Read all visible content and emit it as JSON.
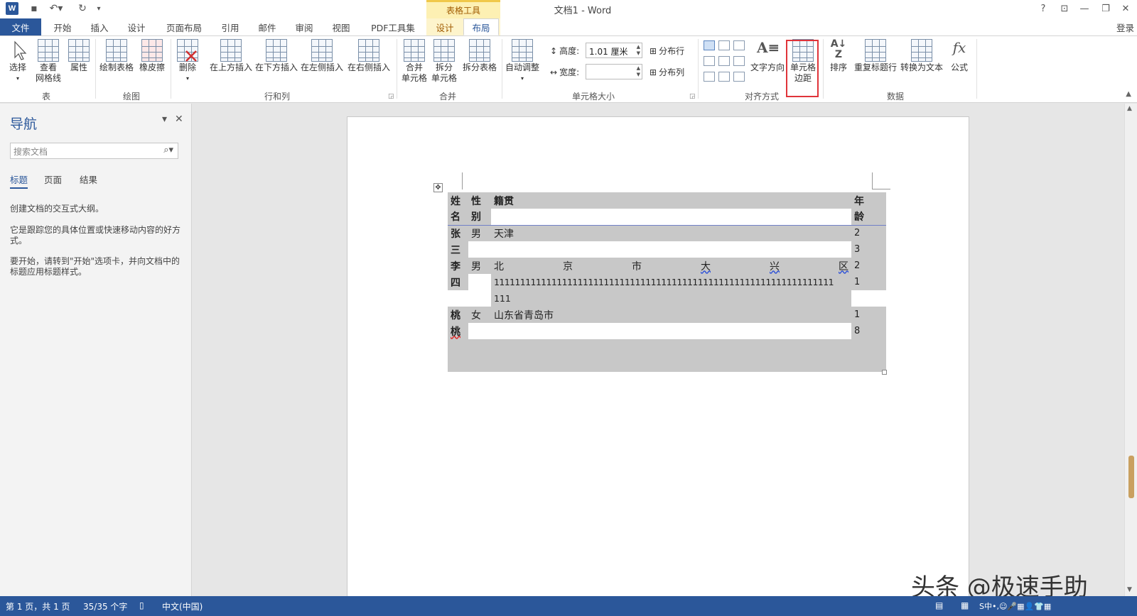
{
  "title_bar": {
    "doc_title": "文档1 - Word",
    "context_group": "表格工具",
    "help": "?",
    "ribbon_display": "⊡",
    "minimize": "—",
    "restore": "❐",
    "close": "✕"
  },
  "tabs": {
    "file": "文件",
    "items": [
      "开始",
      "插入",
      "设计",
      "页面布局",
      "引用",
      "邮件",
      "审阅",
      "视图",
      "PDF工具集"
    ],
    "context_design": "设计",
    "context_layout": "布局",
    "login": "登录"
  },
  "ribbon": {
    "table_group": {
      "label": "表",
      "select": "选择",
      "gridlines_1": "查看",
      "gridlines_2": "网格线",
      "properties": "属性"
    },
    "draw_group": {
      "label": "绘图",
      "draw_table": "绘制表格",
      "eraser": "橡皮擦"
    },
    "rowscols_group": {
      "label": "行和列",
      "delete": "删除",
      "insert_above": "在上方插入",
      "insert_below": "在下方插入",
      "insert_left": "在左侧插入",
      "insert_right": "在右侧插入"
    },
    "merge_group": {
      "label": "合并",
      "merge_1": "合并",
      "merge_2": "单元格",
      "split_1": "拆分",
      "split_2": "单元格",
      "split_table": "拆分表格"
    },
    "cellsize_group": {
      "label": "单元格大小",
      "autofit": "自动调整",
      "height_label": "高度:",
      "height_value": "1.01 厘米",
      "width_label": "宽度:",
      "width_value": "",
      "distribute_rows": "分布行",
      "distribute_cols": "分布列"
    },
    "align_group": {
      "label": "对齐方式",
      "text_direction": "文字方向",
      "cell_margins_1": "单元格",
      "cell_margins_2": "边距"
    },
    "data_group": {
      "label": "数据",
      "sort": "排序",
      "repeat_header": "重复标题行",
      "convert_to_text": "转换为文本",
      "formula": "公式"
    }
  },
  "nav_pane": {
    "title": "导航",
    "search_placeholder": "搜索文档",
    "tabs": [
      "标题",
      "页面",
      "结果"
    ],
    "text1": "创建文档的交互式大纲。",
    "text2": "它是跟踪您的具体位置或快速移动内容的好方式。",
    "text3": "要开始，请转到\"开始\"选项卡，并向文档中的标题应用标题样式。"
  },
  "document_table": {
    "header": {
      "c1a": "姓",
      "c1b": "名",
      "c2a": "性",
      "c2b": "别",
      "c3": "籍贯",
      "c4a": "年",
      "c4b": "龄"
    },
    "rows": [
      {
        "name_a": "张",
        "name_b": "三",
        "gender": "男",
        "origin": "天津",
        "age_a": "2",
        "age_b": "3"
      },
      {
        "name_a": "李",
        "name_b": "四",
        "gender": "男",
        "origin_spaced": [
          "北",
          "京",
          "市",
          "大",
          "兴",
          "区"
        ],
        "origin_line2": "11111111111111111111111111111111111111111111111111111111111111111",
        "origin_line3": "111",
        "age_a": "2",
        "age_b": "1"
      },
      {
        "name_a": "桃",
        "name_b": "桃",
        "gender": "女",
        "origin": "山东省青岛市",
        "age_a": "1",
        "age_b": "8"
      }
    ]
  },
  "status_bar": {
    "page": "第 1 页，共 1 页",
    "words": "35/35 个字",
    "language": "中文(中国)"
  },
  "watermark": "头条 @极速手助"
}
